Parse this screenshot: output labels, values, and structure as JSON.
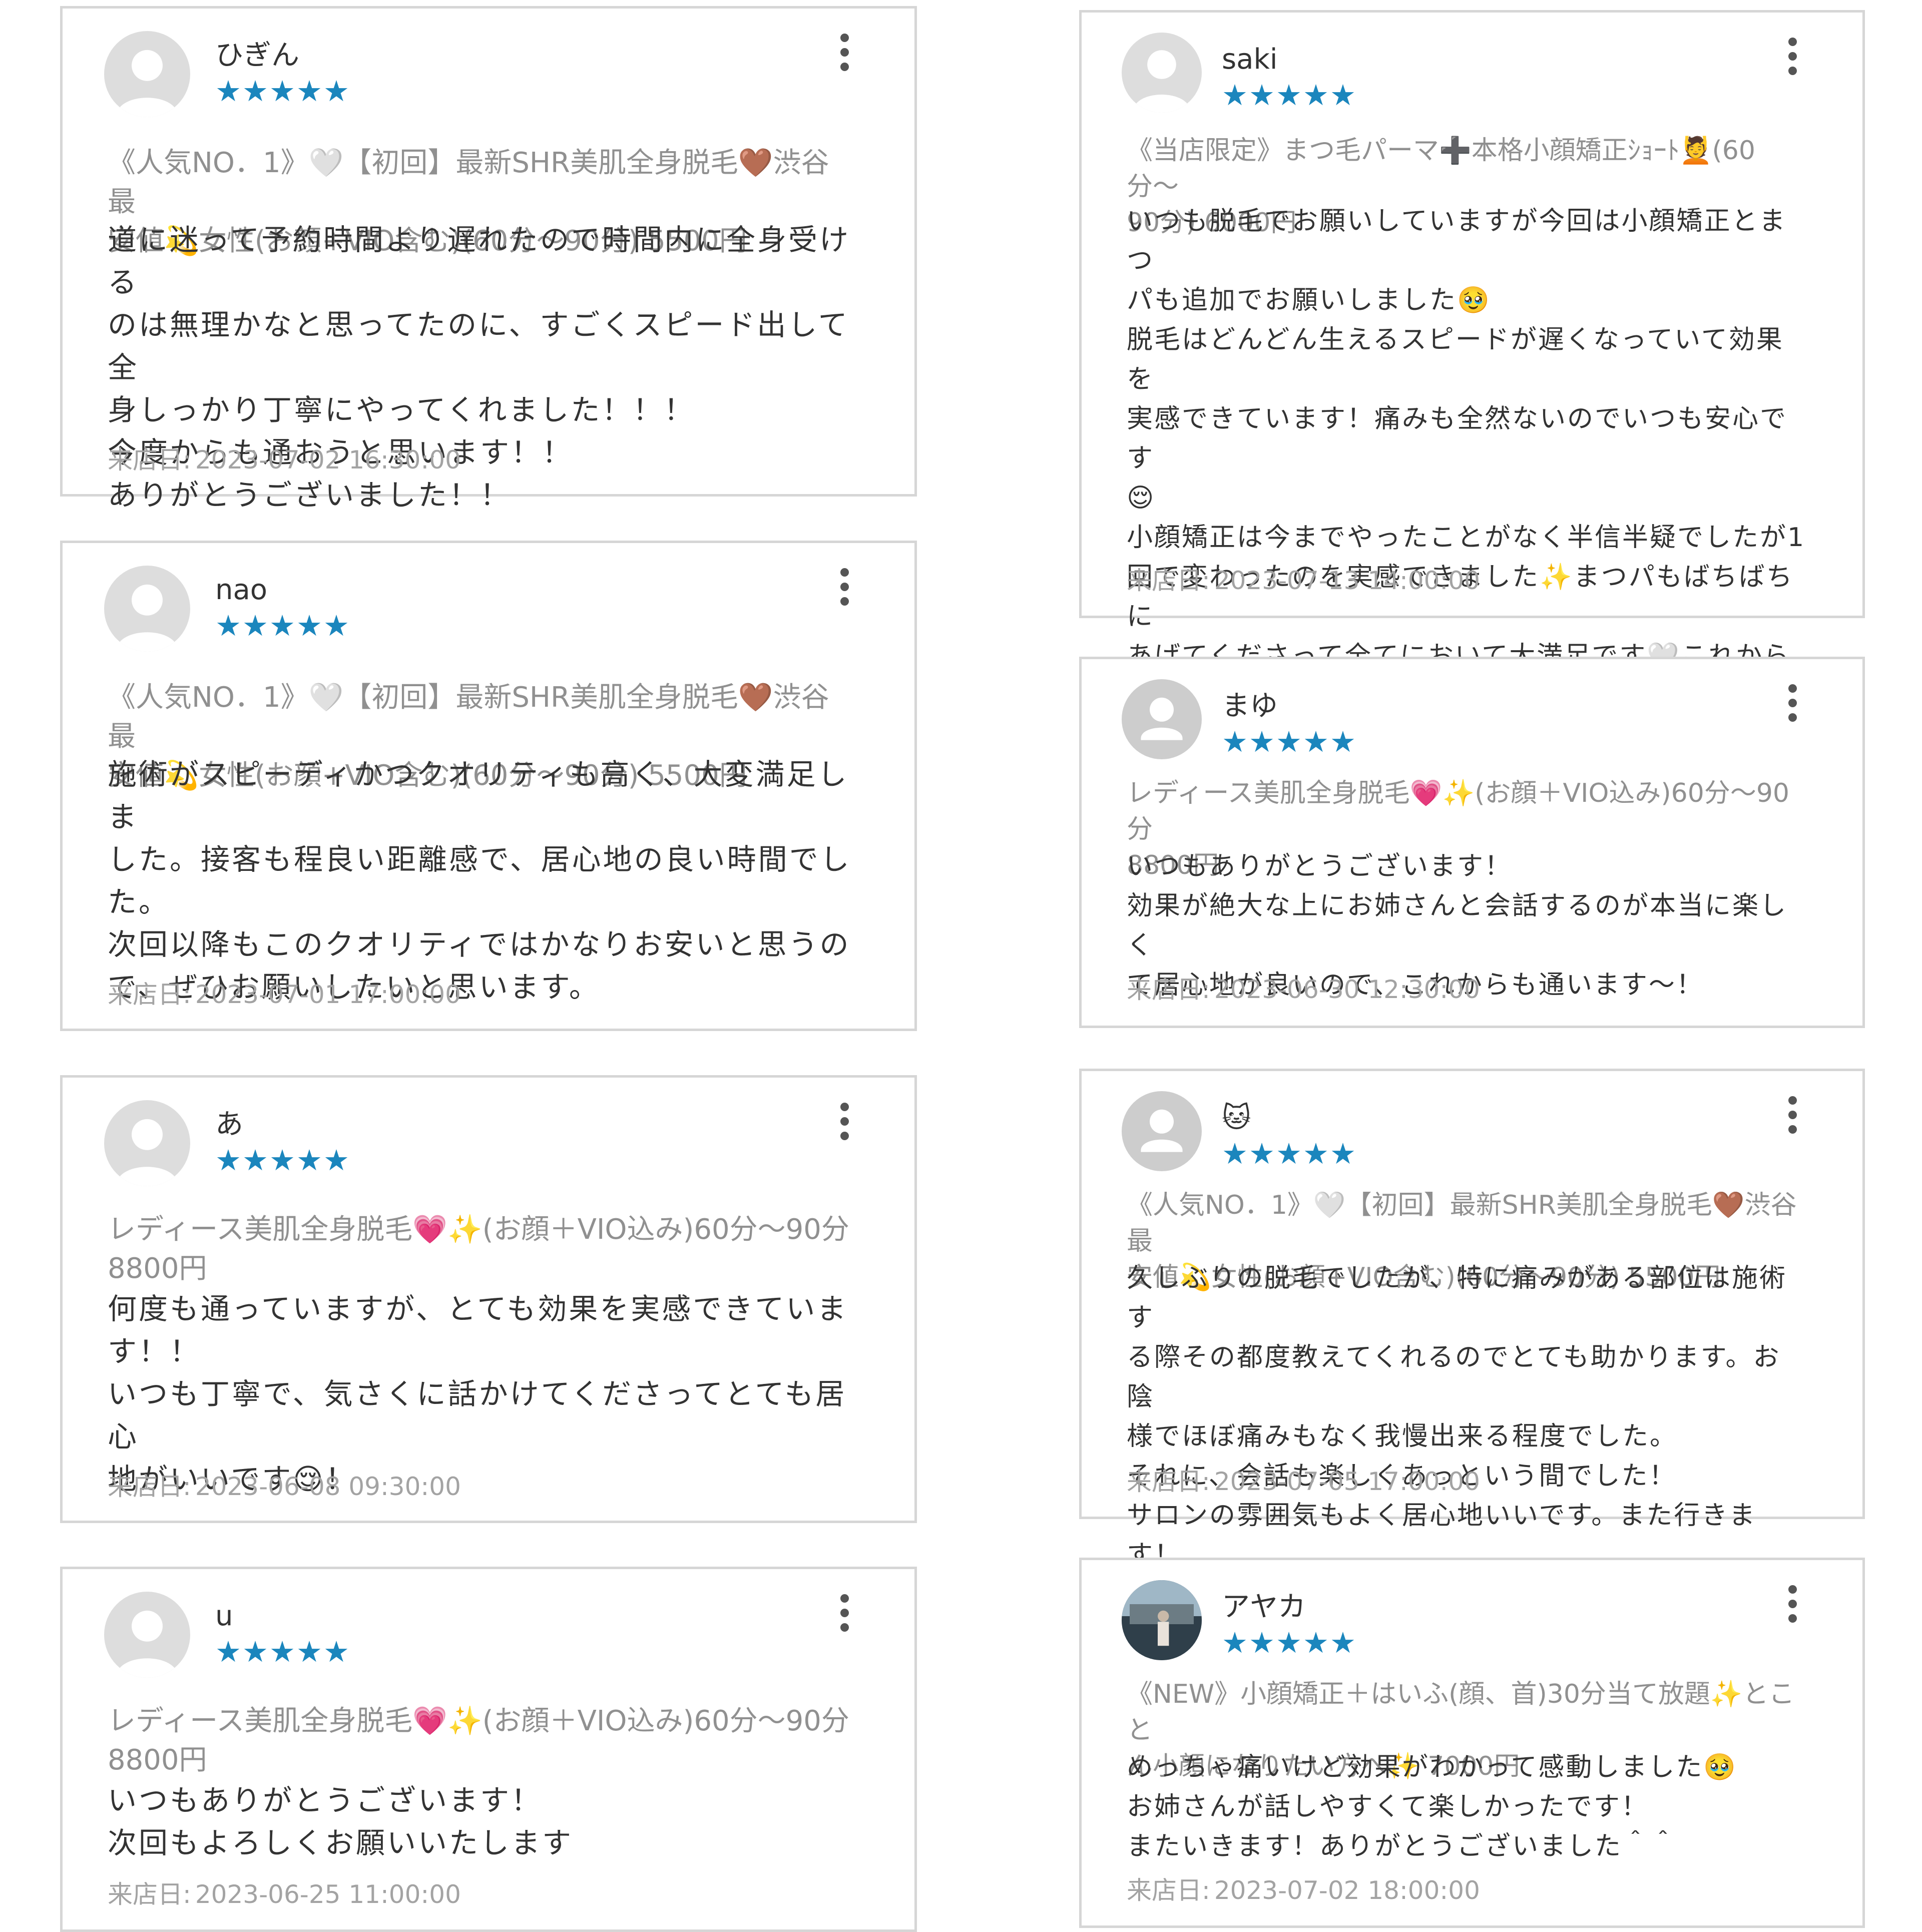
{
  "reviews": [
    {
      "name": "ひぎん",
      "stars": "★★★★★",
      "menu": "《人気NO．1》🤍【初回】最新SHR美肌全身脱毛🤎渋谷最\n安値💫女性(お顔+VIO含む)(60分〜90分) 5500円",
      "body": "道に迷って予約時間より遅れたので時間内に全身受ける\nのは無理かなと思ってたのに、すごくスピード出して全\n身しっかり丁寧にやってくれました！！！\n今度からも通おうと思います！！\nありがとうございました！！",
      "visit_label": "来店日:",
      "visit_date": "2023-07-02 16:30:00",
      "avatar": "person-default"
    },
    {
      "name": "nao",
      "stars": "★★★★★",
      "menu": "《人気NO．1》🤍【初回】最新SHR美肌全身脱毛🤎渋谷最\n安値💫女性(お顔+VIO含む)(60分〜90分) 5500円",
      "body": "施術がスピーディかつクオリティも高く、大変満足しま\nした。接客も程良い距離感で、居心地の良い時間でし\nた。\n次回以降もこのクオリティではかなりお安いと思うの\nで、ぜひお願いしたいと思います。",
      "visit_label": "来店日:",
      "visit_date": "2023-07-01 17:00:00",
      "avatar": "person-default"
    },
    {
      "name": "あ",
      "stars": "★★★★★",
      "menu": "レディース美肌全身脱毛💗✨(お顔＋VIO込み)60分〜90分\n8800円",
      "body": "何度も通っていますが、とても効果を実感できていま\nす！！\nいつも丁寧で、気さくに話かけてくださってとても居心\n地がいいです😌！",
      "visit_label": "来店日:",
      "visit_date": "2023-06-08 09:30:00",
      "avatar": "person-default"
    },
    {
      "name": "u",
      "stars": "★★★★★",
      "menu": "レディース美肌全身脱毛💗✨(お顔＋VIO込み)60分〜90分\n8800円",
      "body": "いつもありがとうございます！\n次回もよろしくお願いいたします",
      "visit_label": "来店日:",
      "visit_date": "2023-06-25 11:00:00",
      "avatar": "person-default"
    },
    {
      "name": "saki",
      "stars": "★★★★★",
      "menu": "《当店限定》まつ毛パーマ➕本格小顔矯正ｼｮｰﾄ💆(60分〜\n90分) 6000円",
      "body": "いつも脱毛でお願いしていますが今回は小顔矯正とまつ\nパも追加でお願いしました🥹\n脱毛はどんどん生えるスピードが遅くなっていて効果を\n実感できています！痛みも全然ないのでいつも安心です\n😌\n小顔矯正は今までやったことがなく半信半疑でしたが1\n回で変わったのを実感できました✨まつパもばちばちに\nあげてくださって全てにおいて大満足です🤍これからも\n通い続けます🥰",
      "visit_label": "来店日:",
      "visit_date": "2023-07-13 14:00:00",
      "avatar": "person-default"
    },
    {
      "name": "まゆ",
      "stars": "★★★★★",
      "menu": "レディース美肌全身脱毛💗✨(お顔＋VIO込み)60分〜90分\n8800円",
      "body": "いつもありがとうございます！\n効果が絶大な上にお姉さんと会話するのが本当に楽しく\nて居心地が良いので、これからも通います〜！",
      "visit_label": "来店日:",
      "visit_date": "2023-06-30 12:30:00",
      "avatar": "person-gray"
    },
    {
      "name": "🐱",
      "stars": "★★★★★",
      "menu": "《人気NO．1》🤍【初回】最新SHR美肌全身脱毛🤎渋谷最\n安値💫女性(お顔+VIO含む)(60分〜90分) 5500円",
      "body": "久しぶりの脱毛でしたが、特に痛みがある部位は施術す\nる際その都度教えてくれるのでとても助かります。お陰\n様でほぼ痛みもなく我慢出来る程度でした。\nそれに、会話も楽しくあっという間でした！\nサロンの雰囲気もよく居心地いいです。また行きます！",
      "visit_label": "来店日:",
      "visit_date": "2023-07-05 17:00:00",
      "avatar": "person-gray"
    },
    {
      "name": "アヤカ",
      "stars": "★★★★★",
      "menu": "《NEW》小顔矯正＋はいふ(顔、首)30分当て放題✨とこと\nん小顔になりたい方へ✨ 7000円",
      "body": "めっちゃ痛いけど効果がわかって感動しました🥹\nお姉さんが話しやすくて楽しかったです！\nまたいきます！ありがとうございました＾＾",
      "visit_label": "来店日:",
      "visit_date": "2023-07-02 18:00:00",
      "avatar": "photo"
    }
  ]
}
